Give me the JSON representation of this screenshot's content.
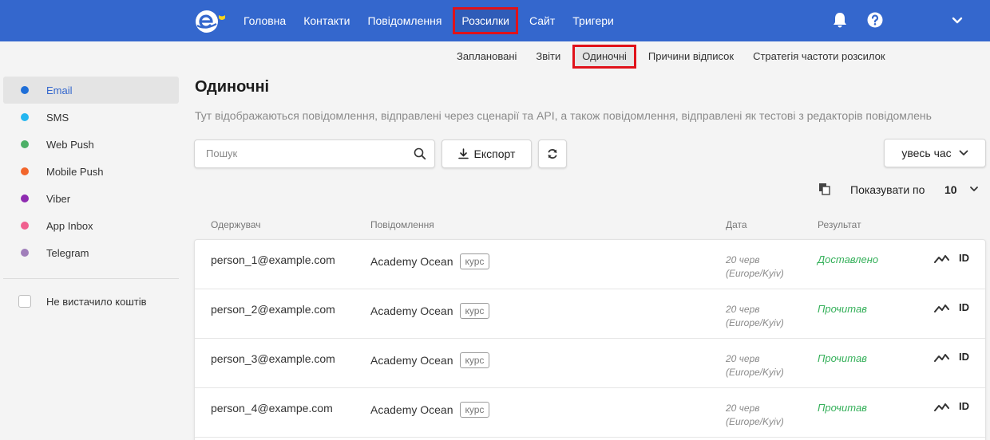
{
  "colors": {
    "brand": "#3467cd",
    "highlight": "#e0121a",
    "success": "#35b05a"
  },
  "topnav": {
    "items": [
      "Головна",
      "Контакти",
      "Повідомлення",
      "Розсилки",
      "Сайт",
      "Тригери"
    ],
    "active": "Розсилки",
    "icons": [
      "logo",
      "bell-icon",
      "help-icon",
      "chevron-down-icon"
    ]
  },
  "subnav": {
    "items": [
      "Заплановані",
      "Звіти",
      "Одиночні",
      "Причини відписок",
      "Стратегія частоти розсилок"
    ],
    "active": "Одиночні"
  },
  "sidebar": {
    "channels": [
      {
        "label": "Email",
        "color": "#1f6fd8",
        "active": true
      },
      {
        "label": "SMS",
        "color": "#24b6f0"
      },
      {
        "label": "Web Push",
        "color": "#4caf66"
      },
      {
        "label": "Mobile Push",
        "color": "#f2652b"
      },
      {
        "label": "Viber",
        "color": "#8e2bb0"
      },
      {
        "label": "App Inbox",
        "color": "#f0608f"
      },
      {
        "label": "Telegram",
        "color": "#a07eba"
      }
    ],
    "checkbox_label": "Не вистачило коштів"
  },
  "page": {
    "title": "Одиночні",
    "description": "Тут відображаються повідомлення, відправлені через сценарії та API, а також повідомлення, відправлені як тестові з редакторів повідомлень"
  },
  "toolbar": {
    "search_placeholder": "Пошук",
    "export_label": "Експорт",
    "period_label": "увесь час",
    "show_label": "Показувати по",
    "show_value": "10"
  },
  "table": {
    "headers": [
      "Одержувач",
      "Повідомлення",
      "Дата",
      "Результат"
    ],
    "rows": [
      {
        "recipient": "person_1@example.com",
        "message": "Academy Ocean",
        "tag": "курс",
        "date": "20 черв",
        "tz": "(Europe/Kyiv)",
        "result": "Доставлено",
        "id": "ID"
      },
      {
        "recipient": "person_2@example.com",
        "message": "Academy Ocean",
        "tag": "курс",
        "date": "20 черв",
        "tz": "(Europe/Kyiv)",
        "result": "Прочитав",
        "id": "ID"
      },
      {
        "recipient": "person_3@example.com",
        "message": "Academy Ocean",
        "tag": "курс",
        "date": "20 черв",
        "tz": "(Europe/Kyiv)",
        "result": "Прочитав",
        "id": "ID"
      },
      {
        "recipient": "person_4@exampe.com",
        "message": "Academy Ocean",
        "tag": "курс",
        "date": "20 черв",
        "tz": "(Europe/Kyiv)",
        "result": "Прочитав",
        "id": "ID"
      }
    ]
  }
}
